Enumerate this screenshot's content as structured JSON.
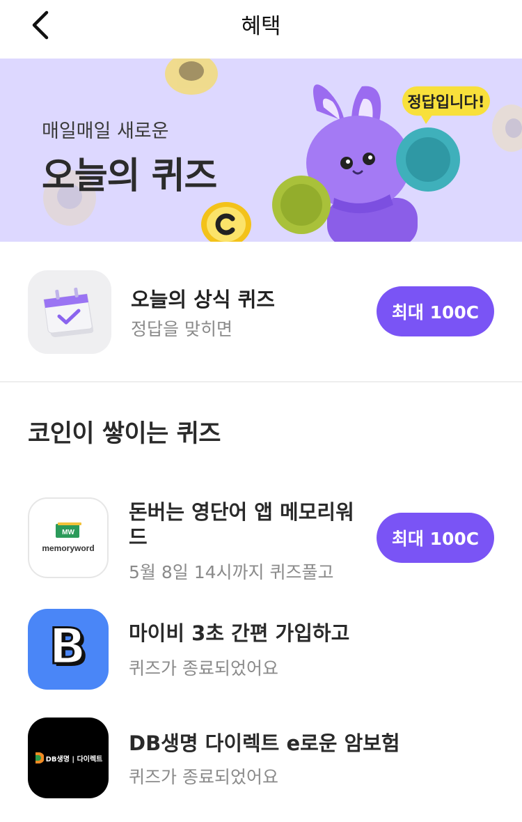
{
  "header": {
    "title": "혜택"
  },
  "banner": {
    "subtitle": "매일매일 새로운",
    "title": "오늘의 퀴즈",
    "bubble": "정답입니다!",
    "colors": {
      "background": "#ddd8ff",
      "character": "#9b6bf0"
    }
  },
  "daily_quiz": {
    "title": "오늘의 상식 퀴즈",
    "subtitle": "정답을 맞히면",
    "button": "최대 100C",
    "icon": "calendar-check-icon"
  },
  "section": {
    "title": "코인이 쌓이는 퀴즈"
  },
  "quizzes": [
    {
      "title_line1": "돈버는 영단어 앱 메모리워",
      "title_line2": "드",
      "subtitle": "5월 8일 14시까지 퀴즈풀고",
      "button": "최대 100C",
      "logo_text": "memoryword",
      "logo_badge": "MW"
    },
    {
      "title": "마이비 3초 간편 가입하고",
      "subtitle": "퀴즈가 종료되었어요",
      "logo_letter": "B"
    },
    {
      "title": "DB생명 다이렉트 e로운 암보험",
      "subtitle": "퀴즈가 종료되었어요",
      "logo_text": "DB생명 | 다이렉트"
    }
  ],
  "colors": {
    "accent": "#7a54f5",
    "muted_text": "#8a8a8a",
    "divider": "#eeeeee"
  }
}
